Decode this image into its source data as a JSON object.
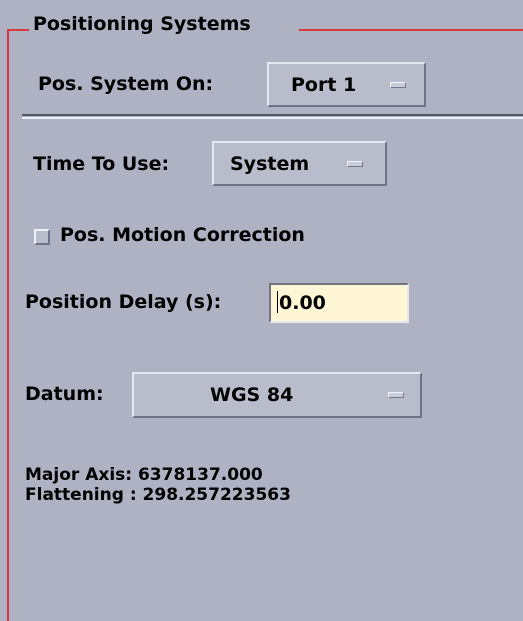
{
  "panel": {
    "title": "Positioning Systems"
  },
  "pos_system": {
    "label": "Pos. System On:",
    "value": "Port 1"
  },
  "time_to_use": {
    "label": "Time To Use:",
    "value": "System"
  },
  "motion_correction": {
    "label": "Pos. Motion Correction",
    "checked": false
  },
  "position_delay": {
    "label": "Position Delay (s):",
    "value": "0.00"
  },
  "datum": {
    "label": "Datum:",
    "value": "WGS 84"
  },
  "ellipsoid": {
    "major_axis": "Major Axis: 6378137.000",
    "flattening": "Flattening : 298.257223563"
  },
  "colors": {
    "background": "#aeb2c3",
    "frame": "#d63a3a",
    "input_background": "#fff6d6"
  },
  "icons": {
    "option_menu": "option-menu-indicator-icon"
  }
}
